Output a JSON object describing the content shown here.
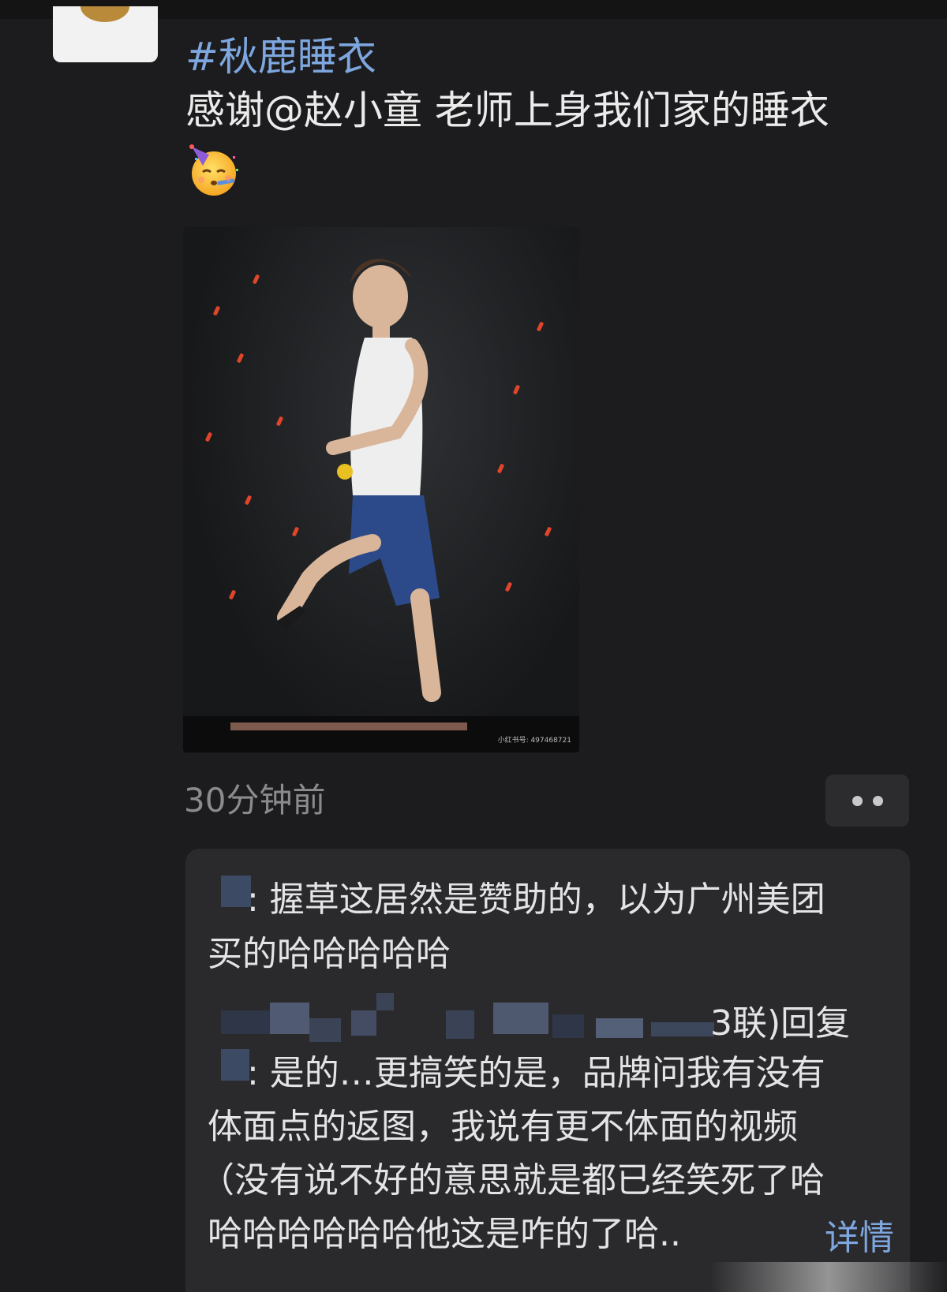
{
  "post": {
    "hashtag": "#秋鹿睡衣",
    "text": "感谢@赵小童 老师上身我们家的睡衣",
    "emoji_name": "partying-face-emoji",
    "timestamp": "30分钟前",
    "photo_watermark": "小红书号: 497468721"
  },
  "comments": {
    "first": {
      "line1": ": 握草这居然是赞助的，以为广州美团",
      "line2": "买的哈哈哈哈哈"
    },
    "reply": {
      "header_tail": "3联)回复",
      "line1": ": 是的…更搞笑的是，品牌问我有没有",
      "line2": "体面点的返图，我说有更不体面的视频",
      "line3": "（没有说不好的意思就是都已经笑死了哈",
      "line4": "哈哈哈哈哈哈他这是咋的了哈..",
      "detail_link": "详情"
    }
  },
  "colors": {
    "background": "#1c1c1e",
    "link": "#7ea7df",
    "card": "#2a2a2c",
    "muted": "#8b8b8f"
  }
}
